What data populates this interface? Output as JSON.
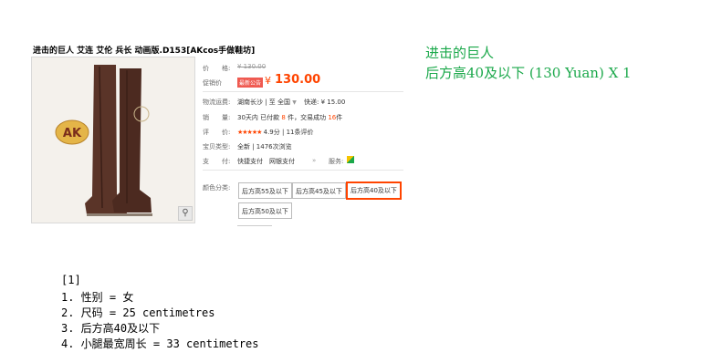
{
  "product": {
    "title": "进击的巨人 艾连 艾伦 兵长 动画版.D153[AKcos手做鞋坊]",
    "watermark_logo": "AK",
    "zoom_icon": "magnifier-icon",
    "price_label": "价　　格:",
    "original_price": "¥ 130.00",
    "promo_label": "促销价",
    "promo_badge": "最新公告",
    "currency": "¥",
    "price": "130.00",
    "shipping_label": "物流运费:",
    "shipping_origin": "湖南长沙 | 至",
    "shipping_dest": "全国",
    "shipping_fee": "快递: ¥ 15.00",
    "sales_label": "销　　量:",
    "sales_prefix": "30天内 已付款",
    "sales_paid": "8",
    "sales_mid": "件，交易成功",
    "sales_success": "16",
    "sales_suffix": "件",
    "rating_label": "评　　价:",
    "rating_stars": "★★★★★",
    "rating_score": "4.9分",
    "rating_count": "| 11条评价",
    "service_label": "宝贝类型:",
    "service_value": "全新 | 1476次浏览",
    "payment_label": "支　　付:",
    "payment_value": "快捷支付　网银支付",
    "payment_more": "»",
    "service2_label": "服务:",
    "color_label": "颜色分类:",
    "options": [
      "后方高55及以下",
      "后方高45及以下",
      "后方高40及以下",
      "后方高50及以下"
    ],
    "selected_option": "后方高40及以下"
  },
  "note": {
    "line1": "进击的巨人",
    "line2": "后方高40及以下 (130 Yuan) X 1"
  },
  "details": {
    "index": "[1]",
    "items": [
      "1. 性别 = 女",
      "2. 尺码 = 25 centimetres",
      "3. 后方高40及以下",
      "4. 小腿最宽周长 = 33 centimetres"
    ]
  }
}
